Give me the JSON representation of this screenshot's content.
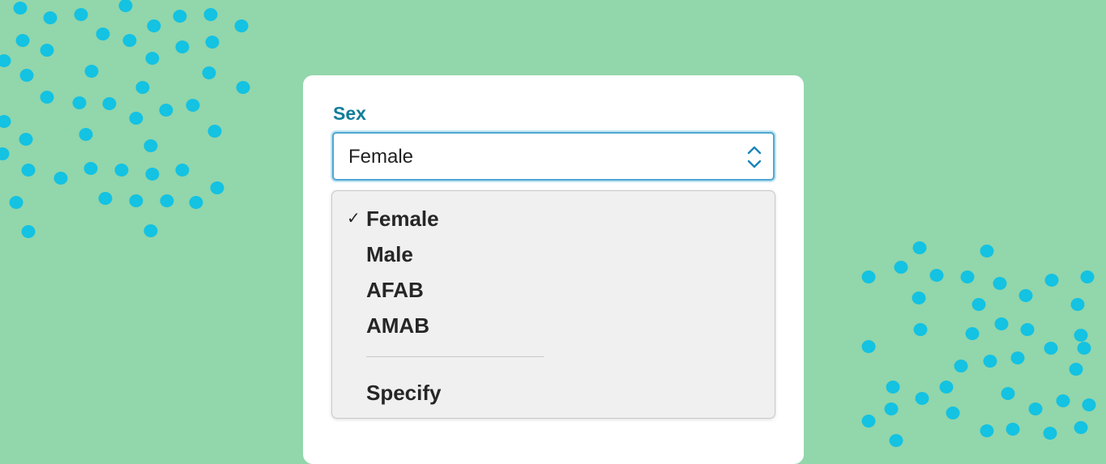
{
  "form": {
    "sex_label": "Sex",
    "sex_selected": "Female"
  },
  "menu": {
    "checkmark": "✓",
    "options": [
      {
        "label": "Female",
        "selected": true
      },
      {
        "label": "Male",
        "selected": false
      },
      {
        "label": "AFAB",
        "selected": false
      },
      {
        "label": "AMAB",
        "selected": false
      }
    ],
    "specify_label": "Specify"
  },
  "colors": {
    "background": "#92d6ab",
    "dots": "#14c2e2",
    "label_accent": "#117e98",
    "select_border": "#4fa6d3"
  }
}
